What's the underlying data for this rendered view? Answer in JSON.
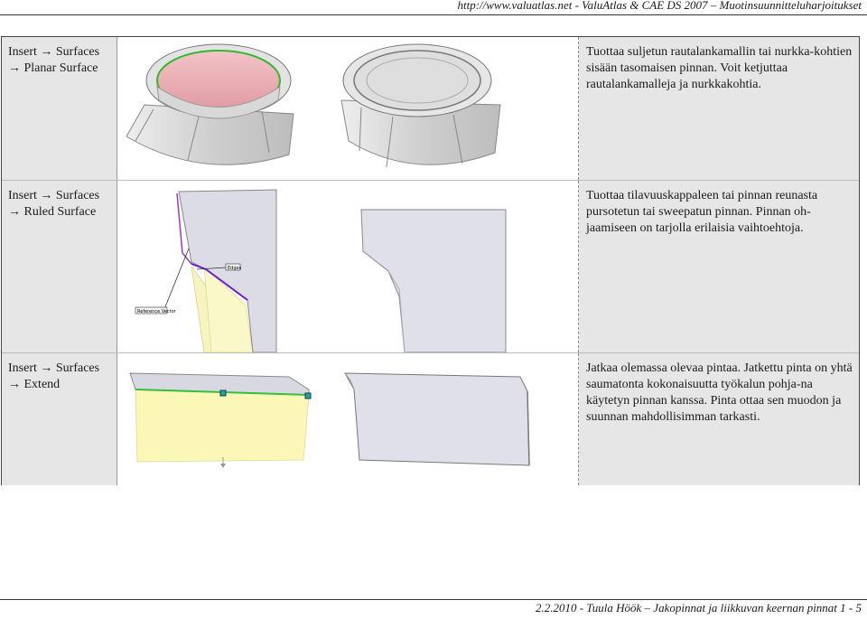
{
  "header": {
    "text": "http://www.valuatlas.net - ValuAtlas & CAE DS 2007 – Muotinsuunnitteluharjoitukset"
  },
  "rows": [
    {
      "menu": [
        "Insert → Surfaces",
        "→ Planar Surface"
      ],
      "description": "Tuottaa suljetun rautalankamallin tai nurkka-kohtien sisään tasomaisen pinnan. Voit ketjuttaa rautalankamalleja ja nurkkakohtia."
    },
    {
      "menu": [
        "Insert → Surfaces",
        "→ Ruled Surface"
      ],
      "description": "Tuottaa tilavuuskappaleen tai pinnan reunasta pursotetun tai sweepatun pinnan. Pinnan oh-jaamiseen on tarjolla erilaisia vaihtoehtoja.",
      "callouts": [
        "Reference Vector",
        "Edges"
      ]
    },
    {
      "menu": [
        "Insert → Surfaces",
        "→ Extend"
      ],
      "description": "Jatkaa olemassa olevaa pintaa. Jatkettu pinta on yhtä saumatonta kokonaisuutta työkalun pohja-na käytetyn pinnan kanssa. Pinta ottaa sen muodon ja suunnan mahdollisimman tarkasti."
    }
  ],
  "footer": {
    "text": "2.2.2010 - Tuula Höök – Jakopinnat ja liikkuvan keernan pinnat 1 - 5"
  }
}
